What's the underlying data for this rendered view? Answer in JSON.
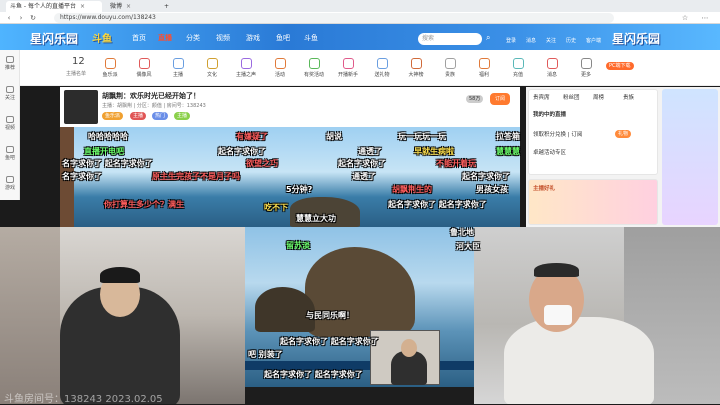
{
  "browser": {
    "tabs": [
      {
        "label": "斗鱼 - 每个人的直播平台",
        "close": "×"
      },
      {
        "label": "微博",
        "close": "×"
      }
    ],
    "new_tab": "+",
    "url": "https://www.douyu.com/138243"
  },
  "header": {
    "logo": "斗鱼",
    "event_logo": "星闪乐园",
    "nav": [
      "首页",
      "直播",
      "分类",
      "视频",
      "游戏",
      "鱼吧",
      "斗鱼"
    ],
    "search_placeholder": "搜索",
    "right_icons": [
      "登录",
      "消息",
      "关注",
      "历史",
      "客户端"
    ]
  },
  "sidebar": {
    "items": [
      "推荐",
      "关注",
      "视频",
      "鱼吧",
      "游戏"
    ]
  },
  "categories": {
    "count": "12",
    "count_label": "主播名单",
    "items": [
      "鱼乐派",
      "偶像风",
      "主播",
      "文化",
      "主播之声",
      "活动",
      "有奖活动",
      "开播新手",
      "送礼物",
      "大神榜",
      "贵族",
      "福利",
      "充值",
      "消息",
      "更多"
    ],
    "pc_badge": "PC端下载"
  },
  "streamer": {
    "title": "胡飘荆：欢乐时光已经开始了！",
    "sub": "主播：胡飘荆  |  分区：颜值  |  房间号：138243",
    "tags": [
      "鱼乐派",
      "主播",
      "热门",
      "主播"
    ],
    "follow": "订阅",
    "count": "58万"
  },
  "rightpanel": {
    "tabs": [
      "贵宾席",
      "粉丝团",
      "周榜",
      "贵族"
    ],
    "rank_title": "我的中的直播",
    "card1": "领取积分兑换 | 订阅",
    "card2": "卓越活动专区",
    "gift_label": "礼物",
    "promo": "主播好礼"
  },
  "danmu": [
    {
      "text": "哈哈哈哈哈",
      "color": "#ffffff"
    },
    {
      "text": "有嫌疑了",
      "color": "#ff5c5c"
    },
    {
      "text": "胡说",
      "color": "#ffffff"
    },
    {
      "text": "玩一玩玩一玩",
      "color": "#ffffff"
    },
    {
      "text": "拉答箱",
      "color": "#ffffff"
    },
    {
      "text": "直播开电吧",
      "color": "#6cff6c"
    },
    {
      "text": "起名字求你了",
      "color": "#ffffff"
    },
    {
      "text": "通透了",
      "color": "#ffffff"
    },
    {
      "text": "早就生病啦",
      "color": "#ffe14d"
    },
    {
      "text": "慧慧慧",
      "color": "#6cff6c"
    },
    {
      "text": "名字求你了 起名字求你了",
      "color": "#ffffff"
    },
    {
      "text": "欲望之巧",
      "color": "#ff5c5c"
    },
    {
      "text": "起名字求你了",
      "color": "#ffffff"
    },
    {
      "text": "不能开着玩",
      "color": "#ff5c5c"
    },
    {
      "text": "名字求你了",
      "color": "#ffffff"
    },
    {
      "text": "原主生完孩子不是月子吗",
      "color": "#ff5c5c"
    },
    {
      "text": "通透了",
      "color": "#ffffff"
    },
    {
      "text": "起名字求你了",
      "color": "#ffffff"
    },
    {
      "text": "5分钟?",
      "color": "#ffffff"
    },
    {
      "text": "胡飘荆生的",
      "color": "#ff5c5c"
    },
    {
      "text": "男孩女孩",
      "color": "#ffffff"
    },
    {
      "text": "你打算生多少个？满生",
      "color": "#ff5c5c"
    },
    {
      "text": "起名字求你了 起名字求你了",
      "color": "#ffffff"
    },
    {
      "text": "慧慧立大功",
      "color": "#ffffff"
    },
    {
      "text": "留苏淡",
      "color": "#6cff6c"
    },
    {
      "text": "吃不下",
      "color": "#ffe14d"
    },
    {
      "text": "鲁北地",
      "color": "#ffffff"
    },
    {
      "text": "河大臣",
      "color": "#ffffff"
    },
    {
      "text": "与民同乐啊！",
      "color": "#ffffff"
    },
    {
      "text": "起名字求你了 起名字求你了",
      "color": "#ffffff"
    },
    {
      "text": "吧 别装了",
      "color": "#ffffff"
    },
    {
      "text": "起名字求你了 起名字求你了",
      "color": "#ffffff"
    }
  ],
  "watermark": "斗鱼房间号：138243  2023.02.05"
}
